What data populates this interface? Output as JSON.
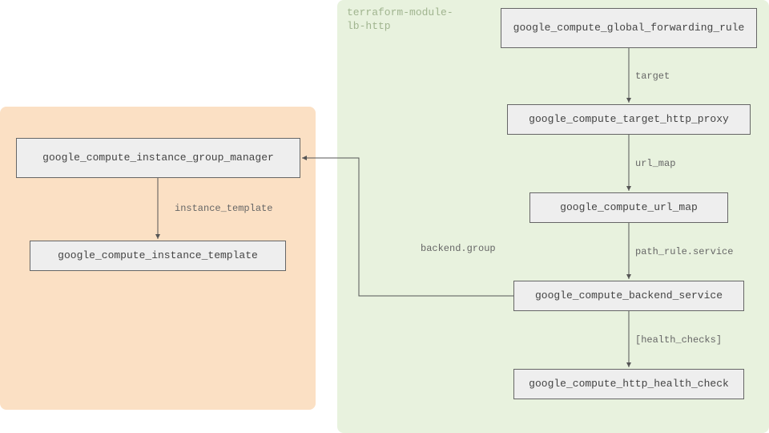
{
  "groups": {
    "orange": {
      "label": ""
    },
    "green": {
      "label": "terraform-module-\nlb-http"
    }
  },
  "nodes": {
    "igm": {
      "label": "google_compute_instance_group_manager"
    },
    "tmpl": {
      "label": "google_compute_instance_template"
    },
    "fwd": {
      "label": "google_compute_global_forwarding_rule"
    },
    "proxy": {
      "label": "google_compute_target_http_proxy"
    },
    "urlmap": {
      "label": "google_compute_url_map"
    },
    "backend": {
      "label": "google_compute_backend_service"
    },
    "health": {
      "label": "google_compute_http_health_check"
    }
  },
  "edges": {
    "igm_tmpl": {
      "label": "instance_template"
    },
    "fwd_proxy": {
      "label": "target"
    },
    "proxy_urlmap": {
      "label": "url_map"
    },
    "urlmap_backend": {
      "label": "path_rule.service"
    },
    "backend_health": {
      "label": "[health_checks]"
    },
    "backend_igm": {
      "label": "backend.group"
    }
  },
  "chart_data": {
    "type": "diagram",
    "title": "",
    "clusters": [
      {
        "id": "orange",
        "label": "",
        "nodes": [
          "igm",
          "tmpl"
        ]
      },
      {
        "id": "green",
        "label": "terraform-module-lb-http",
        "nodes": [
          "fwd",
          "proxy",
          "urlmap",
          "backend",
          "health"
        ]
      }
    ],
    "nodes": [
      {
        "id": "igm",
        "label": "google_compute_instance_group_manager"
      },
      {
        "id": "tmpl",
        "label": "google_compute_instance_template"
      },
      {
        "id": "fwd",
        "label": "google_compute_global_forwarding_rule"
      },
      {
        "id": "proxy",
        "label": "google_compute_target_http_proxy"
      },
      {
        "id": "urlmap",
        "label": "google_compute_url_map"
      },
      {
        "id": "backend",
        "label": "google_compute_backend_service"
      },
      {
        "id": "health",
        "label": "google_compute_http_health_check"
      }
    ],
    "edges": [
      {
        "from": "igm",
        "to": "tmpl",
        "label": "instance_template"
      },
      {
        "from": "fwd",
        "to": "proxy",
        "label": "target"
      },
      {
        "from": "proxy",
        "to": "urlmap",
        "label": "url_map"
      },
      {
        "from": "urlmap",
        "to": "backend",
        "label": "path_rule.service"
      },
      {
        "from": "backend",
        "to": "health",
        "label": "[health_checks]"
      },
      {
        "from": "backend",
        "to": "igm",
        "label": "backend.group"
      }
    ]
  }
}
